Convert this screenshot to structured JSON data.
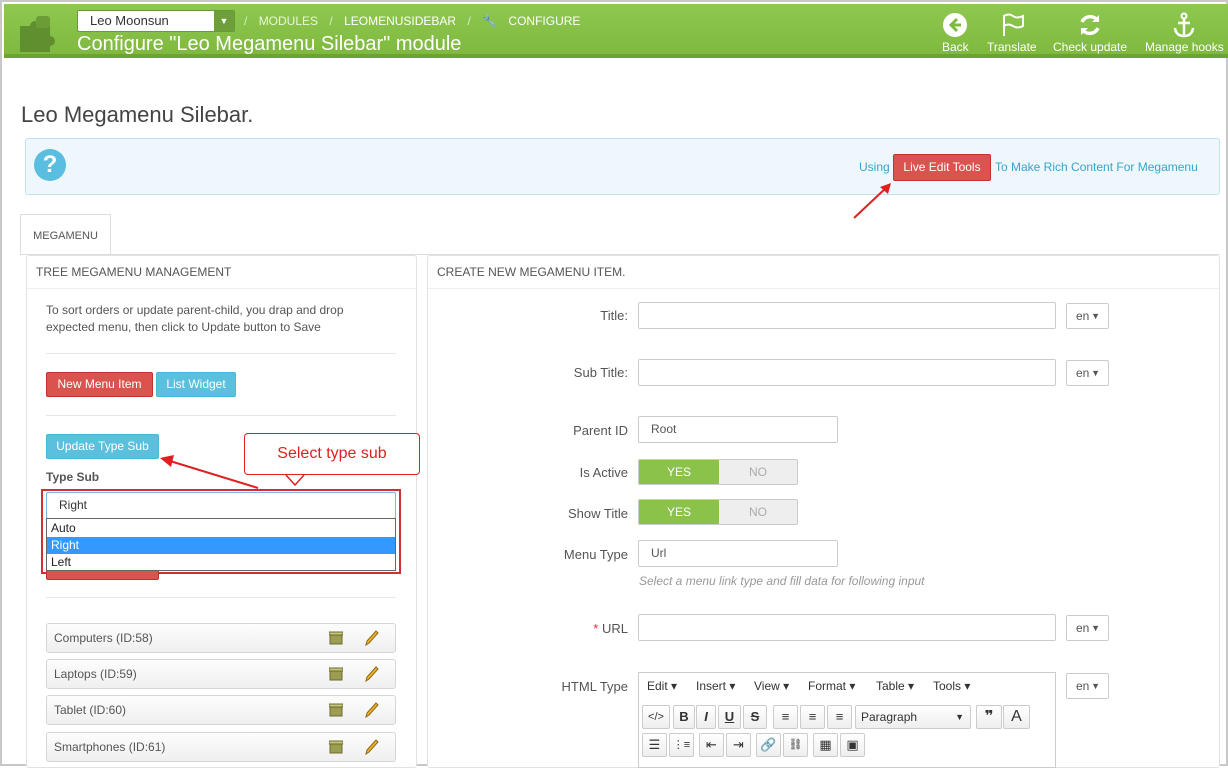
{
  "header": {
    "shop_name": "Leo Moonsun",
    "breadcrumbs": [
      "MODULES",
      "LEOMENUSIDEBAR",
      "CONFIGURE"
    ],
    "page_heading": "Configure \"Leo Megamenu Silebar\" module",
    "toolbar": {
      "back": "Back",
      "translate": "Translate",
      "check_update": "Check update",
      "manage_hooks": "Manage hooks"
    }
  },
  "page_title": "Leo Megamenu Silebar.",
  "info": {
    "using": "Using",
    "live_edit": "Live Edit Tools",
    "rest": "To Make Rich Content For Megamenu"
  },
  "tab": "MEGAMENU",
  "tree_panel": {
    "title": "TREE MEGAMENU MANAGEMENT",
    "help": "To sort orders or update parent-child, you drap and drop expected menu, then click to Update button to Save",
    "new_menu_item": "New Menu Item",
    "list_widget": "List Widget",
    "update_type_sub": "Update Type Sub",
    "type_sub_label": "Type Sub",
    "type_sub_value": "Right",
    "type_sub_options": [
      "Auto",
      "Right",
      "Left"
    ],
    "items": [
      "Computers (ID:58)",
      "Laptops (ID:59)",
      "Tablet (ID:60)",
      "Smartphones (ID:61)"
    ]
  },
  "callout": "Select type sub",
  "form_panel": {
    "title": "CREATE NEW MEGAMENU ITEM.",
    "title_label": "Title:",
    "subtitle_label": "Sub Title:",
    "parent_label": "Parent ID",
    "parent_value": "Root",
    "active_label": "Is Active",
    "show_title_label": "Show Title",
    "yes": "YES",
    "no": "NO",
    "menu_type_label": "Menu Type",
    "menu_type_value": "Url",
    "menu_type_hint": "Select a menu link type and fill data for following input",
    "url_required": "*",
    "url_label": "URL",
    "html_label": "HTML Type",
    "lang": "en",
    "editor_menus": [
      "Edit",
      "Insert",
      "View",
      "Format",
      "Table",
      "Tools"
    ],
    "paragraph": "Paragraph"
  }
}
